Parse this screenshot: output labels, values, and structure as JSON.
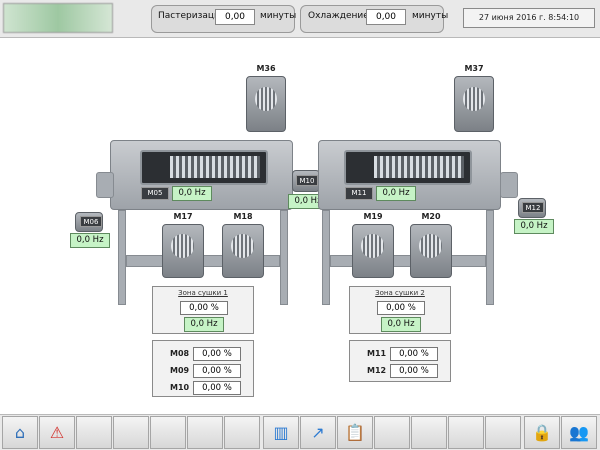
{
  "header": {
    "past_label": "Пастеризация",
    "past_value": "0,00",
    "past_unit": "минуты",
    "cool_label": "Охлаждение",
    "cool_value": "0,00",
    "cool_unit": "минуты",
    "datetime": "27 июня 2016 г. 8:54:10"
  },
  "motors": {
    "m36": "M36",
    "m37": "M37",
    "m05": "M05",
    "m06": "M06",
    "m10": "M10",
    "m11": "M11",
    "m12": "M12",
    "m17": "M17",
    "m18": "M18",
    "m19": "M19",
    "m20": "M20"
  },
  "freq": {
    "m05": "0,0 Hz",
    "m06": "0,0 Hz",
    "m10": "0,0 Hz",
    "m11": "0,0 Hz",
    "m12": "0,0 Hz",
    "zone1": "0,0 Hz",
    "zone2": "0,0 Hz"
  },
  "zone1": {
    "title": "Зона сушки 1",
    "percent": "0,00 %",
    "rows": [
      {
        "label": "M08",
        "value": "0,00 %"
      },
      {
        "label": "M09",
        "value": "0,00 %"
      },
      {
        "label": "M10",
        "value": "0,00 %"
      }
    ]
  },
  "zone2": {
    "title": "Зона сушки 2",
    "percent": "0,00 %",
    "rows": [
      {
        "label": "M11",
        "value": "0,00 %"
      },
      {
        "label": "M12",
        "value": "0,00 %"
      }
    ]
  },
  "footer_icons": [
    "home-icon",
    "alarm-icon",
    "chart-icon",
    "trend-icon",
    "clipboard-icon",
    "lock-icon",
    "users-icon"
  ]
}
